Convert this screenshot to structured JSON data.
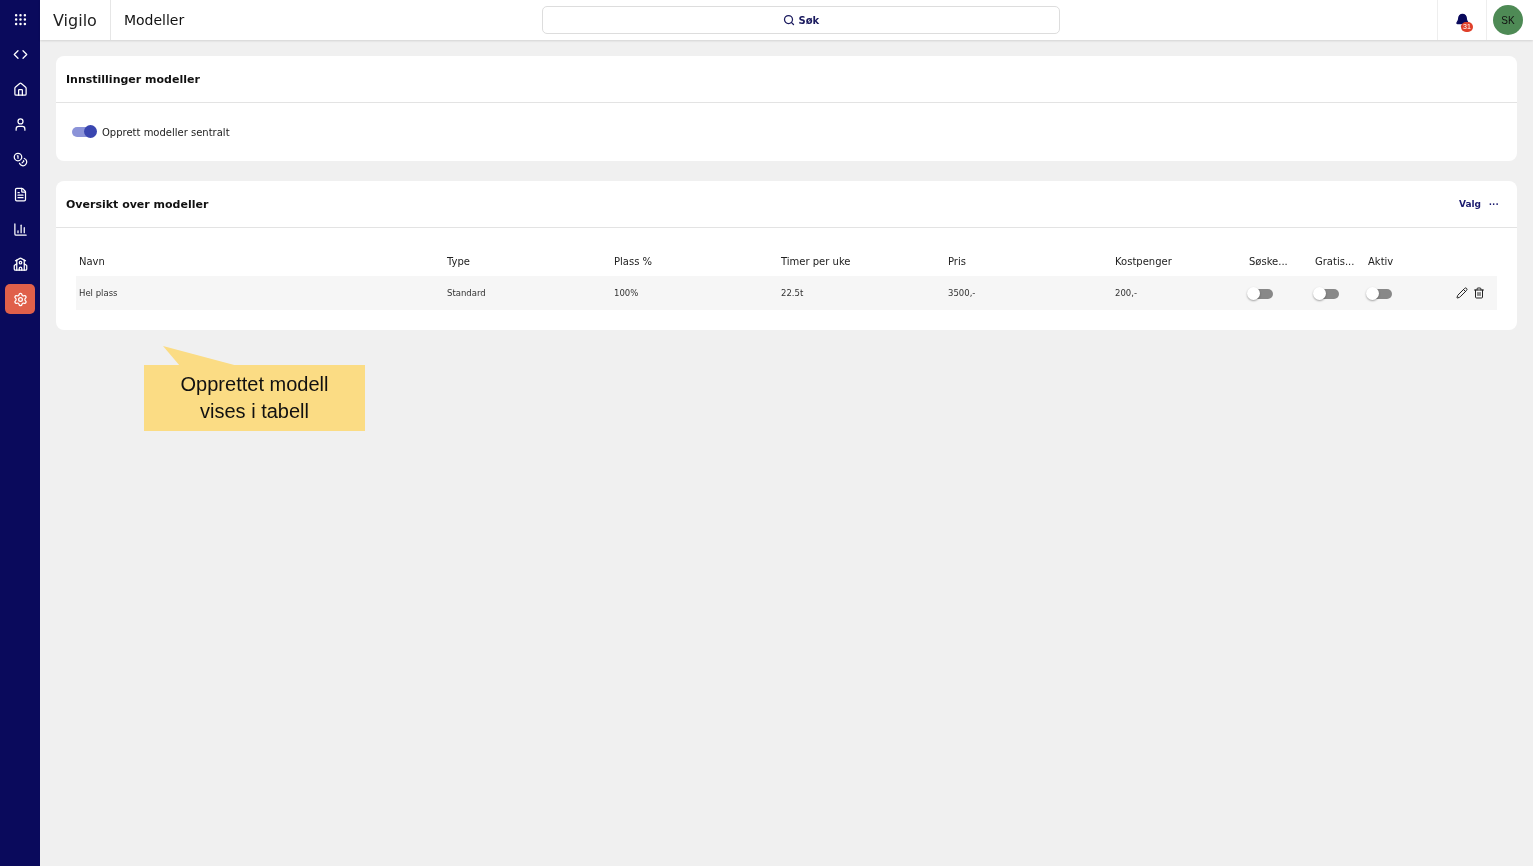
{
  "sidebar": {
    "items": [
      {
        "kind": "apps",
        "selected": false
      },
      {
        "kind": "collapse",
        "selected": false
      },
      {
        "kind": "home",
        "selected": false
      },
      {
        "kind": "person",
        "selected": false
      },
      {
        "kind": "coins",
        "selected": false
      },
      {
        "kind": "document",
        "selected": false
      },
      {
        "kind": "chart",
        "selected": false
      },
      {
        "kind": "building",
        "selected": false
      },
      {
        "kind": "settings",
        "selected": true
      }
    ]
  },
  "header": {
    "logo": "Vigilo",
    "title": "Modeller",
    "search": {
      "placeholder": "Søk"
    },
    "notifications": "31",
    "avatar": "SK"
  },
  "settings_card": {
    "title": "Innstillinger modeller",
    "toggle": {
      "label": "Opprett modeller sentralt",
      "on": true
    }
  },
  "models_card": {
    "title": "Oversikt over modeller",
    "options": "Valg",
    "more": "···",
    "table": {
      "columns": [
        "Navn",
        "Type",
        "Plass %",
        "Timer per uke",
        "Pris",
        "Kostpenger",
        "Søske...",
        "Gratis...",
        "Aktiv"
      ],
      "rows": [
        {
          "cells": [
            "Hel plass",
            "Standard",
            "100%",
            "22.5t",
            "3500,-",
            "200,-"
          ],
          "toggles": [
            false,
            false,
            false
          ]
        }
      ]
    }
  },
  "callout": {
    "text": "Opprettet modell vises i tabell"
  }
}
